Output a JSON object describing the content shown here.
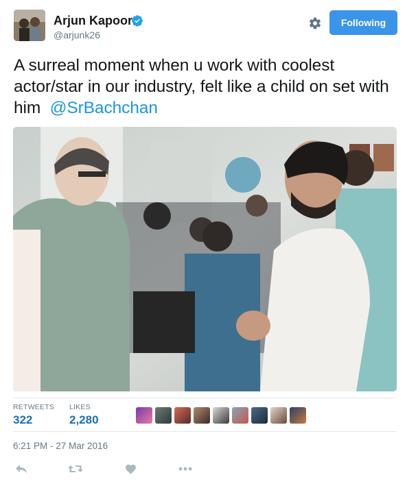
{
  "author": {
    "name": "Arjun Kapoor",
    "handle": "@arjunk26",
    "verified": true
  },
  "follow_button": {
    "label": "Following",
    "color": "#3a94e8"
  },
  "tweet": {
    "text_before": "A surreal moment when u work with coolest actor/star in our industry, felt like a child on set with him",
    "mention": "@SrBachchan",
    "mention_color": "#1b95e0"
  },
  "stats": {
    "retweets_label": "RETWEETS",
    "retweets_value": "322",
    "likes_label": "LIKES",
    "likes_value": "2,280"
  },
  "likers": [
    {
      "name": "liker-1"
    },
    {
      "name": "liker-2"
    },
    {
      "name": "liker-3"
    },
    {
      "name": "liker-4"
    },
    {
      "name": "liker-5"
    },
    {
      "name": "liker-6"
    },
    {
      "name": "liker-7"
    },
    {
      "name": "liker-8"
    },
    {
      "name": "liker-9"
    }
  ],
  "timestamp": "6:21 PM - 27 Mar 2016",
  "actions": [
    "reply-icon",
    "retweet-icon",
    "like-icon",
    "more-icon"
  ],
  "icons": {
    "settings": "gear-icon",
    "verified": "verified-badge-icon"
  }
}
